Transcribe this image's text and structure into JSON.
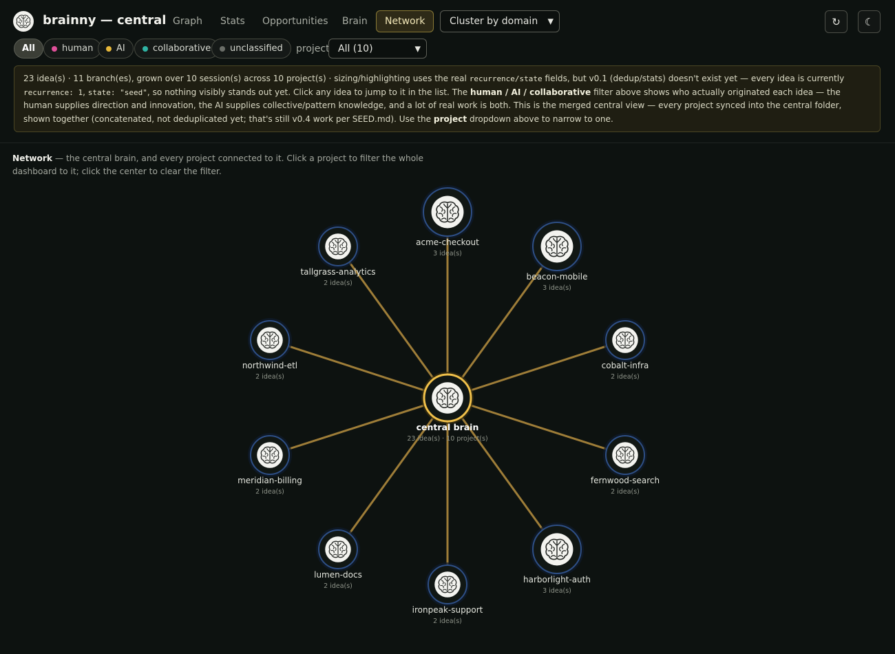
{
  "app": {
    "title": "brainny — central",
    "logo_icon": "brain-icon"
  },
  "tabs": [
    {
      "label": "Graph",
      "active": false
    },
    {
      "label": "Stats",
      "active": false
    },
    {
      "label": "Opportunities",
      "active": false
    },
    {
      "label": "Brain",
      "active": false
    },
    {
      "label": "Network",
      "active": true
    }
  ],
  "cluster_select": {
    "value": "Cluster by domain"
  },
  "actions": {
    "refresh_icon": "↻",
    "theme_icon": "☾"
  },
  "filters": {
    "pills": [
      {
        "label": "All",
        "active": true,
        "color": ""
      },
      {
        "label": "human",
        "active": false,
        "color": "#e0509a"
      },
      {
        "label": "AI",
        "active": false,
        "color": "#e7b83a"
      },
      {
        "label": "collaborative",
        "active": false,
        "color": "#2fb3a3"
      },
      {
        "label": "unclassified",
        "active": false,
        "color": "#6b6e68"
      }
    ],
    "project_label": "project",
    "project_value": "All (10)"
  },
  "notice": {
    "t1": "23 idea(s) · 11 branch(es), grown over 10 session(s) across 10 project(s) · sizing/highlighting uses the real ",
    "c1": "recurrence/state",
    "t2": " fields, but v0.1 (dedup/stats) doesn't exist yet — every idea is currently ",
    "c2": "recurrence: 1",
    "t3": ", ",
    "c3": "state: \"seed\"",
    "t4": ", so nothing visibly stands out yet. Click any idea to jump to it in the list. The ",
    "b1": "human / AI / collaborative",
    "t5": " filter above shows who actually originated each idea — the human supplies direction and innovation, the AI supplies collective/pattern knowledge, and a lot of real work is both. This is the merged central view — every project synced into the central folder, shown together (concatenated, not deduplicated yet; that's still v0.4 work per SEED.md). Use the ",
    "b2": "project",
    "t6": " dropdown above to narrow to one."
  },
  "network_desc": {
    "title": "Network",
    "text": " — the central brain, and every project connected to it. Click a project to filter the whole dashboard to it; click the center to clear the filter."
  },
  "network": {
    "center": {
      "name": "central brain",
      "sub": "23 idea(s) · 10 project(s)"
    },
    "edge_color": "#b8913f",
    "projects": [
      {
        "name": "acme-checkout",
        "ideas": "3 idea(s)"
      },
      {
        "name": "beacon-mobile",
        "ideas": "3 idea(s)"
      },
      {
        "name": "cobalt-infra",
        "ideas": "2 idea(s)"
      },
      {
        "name": "fernwood-search",
        "ideas": "2 idea(s)"
      },
      {
        "name": "harborlight-auth",
        "ideas": "3 idea(s)"
      },
      {
        "name": "ironpeak-support",
        "ideas": "2 idea(s)"
      },
      {
        "name": "lumen-docs",
        "ideas": "2 idea(s)"
      },
      {
        "name": "meridian-billing",
        "ideas": "2 idea(s)"
      },
      {
        "name": "northwind-etl",
        "ideas": "2 idea(s)"
      },
      {
        "name": "tallgrass-analytics",
        "ideas": "2 idea(s)"
      }
    ]
  }
}
